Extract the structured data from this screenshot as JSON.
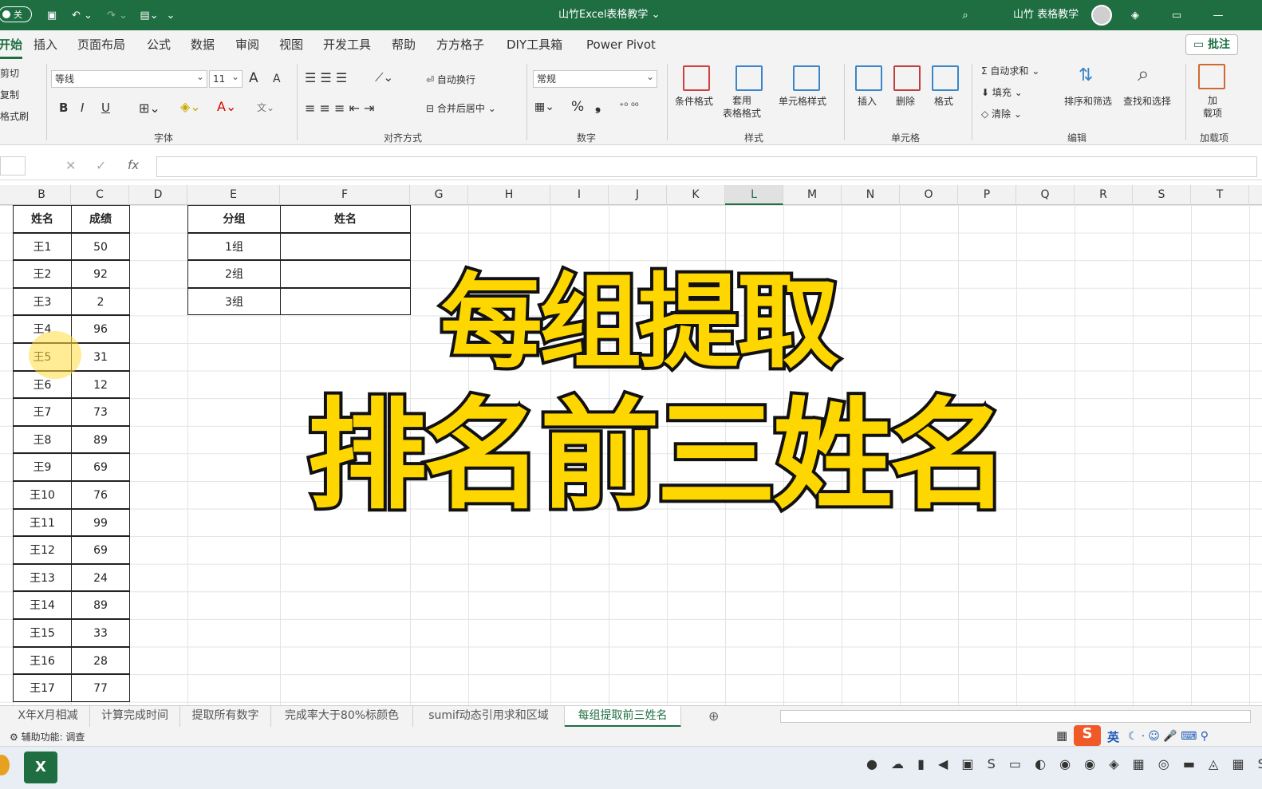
{
  "titlebar": {
    "autosave": "关",
    "title": "山竹Excel表格教学 ⌄",
    "user": "山竹 表格教学"
  },
  "menu": {
    "tabs": [
      "开始",
      "插入",
      "页面布局",
      "公式",
      "数据",
      "审阅",
      "视图",
      "开发工具",
      "帮助",
      "方方格子",
      "DIY工具箱",
      "Power Pivot"
    ],
    "comment": "批注"
  },
  "ribbon": {
    "clipboard": {
      "cut": "剪切",
      "copy": "复制",
      "format_painter": "格式刷"
    },
    "font": {
      "name": "等线",
      "size": "11",
      "grow": "A",
      "shrink": "A",
      "bold": "B",
      "italic": "I",
      "underline": "U",
      "label": "字体"
    },
    "alignment": {
      "wrap": "自动换行",
      "merge": "合并后居中",
      "label": "对齐方式"
    },
    "number": {
      "format": "常规",
      "percent": "%",
      "comma": "❟",
      "label": "数字"
    },
    "styles": {
      "conditional": "条件格式",
      "table_format": "套用\n表格格式",
      "cell_style": "单元格样式",
      "label": "样式"
    },
    "cells": {
      "insert": "插入",
      "delete": "删除",
      "format": "格式",
      "label": "单元格"
    },
    "editing": {
      "autosum": "自动求和",
      "fill": "填充",
      "clear": "清除",
      "sort": "排序和筛选",
      "find": "查找和选择",
      "label": "编辑"
    },
    "addins": {
      "addin": "加\n载项",
      "label": "加载项"
    }
  },
  "formula": {
    "fx": "fx"
  },
  "columns": [
    "B",
    "C",
    "D",
    "E",
    "F",
    "G",
    "H",
    "I",
    "J",
    "K",
    "L",
    "M",
    "N",
    "O",
    "P",
    "Q",
    "R",
    "S",
    "T"
  ],
  "table1": {
    "headers": [
      "姓名",
      "成绩"
    ],
    "rows": [
      [
        "王1",
        "50"
      ],
      [
        "王2",
        "92"
      ],
      [
        "王3",
        "2"
      ],
      [
        "王4",
        "96"
      ],
      [
        "王5",
        "31"
      ],
      [
        "王6",
        "12"
      ],
      [
        "王7",
        "73"
      ],
      [
        "王8",
        "89"
      ],
      [
        "王9",
        "69"
      ],
      [
        "王10",
        "76"
      ],
      [
        "王11",
        "99"
      ],
      [
        "王12",
        "69"
      ],
      [
        "王13",
        "24"
      ],
      [
        "王14",
        "89"
      ],
      [
        "王15",
        "33"
      ],
      [
        "王16",
        "28"
      ],
      [
        "王17",
        "77"
      ]
    ]
  },
  "table2": {
    "headers": [
      "分组",
      "姓名"
    ],
    "rows": [
      "1组",
      "2组",
      "3组"
    ]
  },
  "overlay": {
    "line1": "每组提取",
    "line2": "排名前三姓名"
  },
  "sheets": [
    "X年X月相减",
    "计算完成时间",
    "提取所有数字",
    "完成率大于80%标颜色",
    "sumif动态引用求和区域",
    "每组提取前三姓名"
  ],
  "status": {
    "accessibility": "辅助功能: 调查"
  },
  "ime": {
    "lang": "英"
  }
}
